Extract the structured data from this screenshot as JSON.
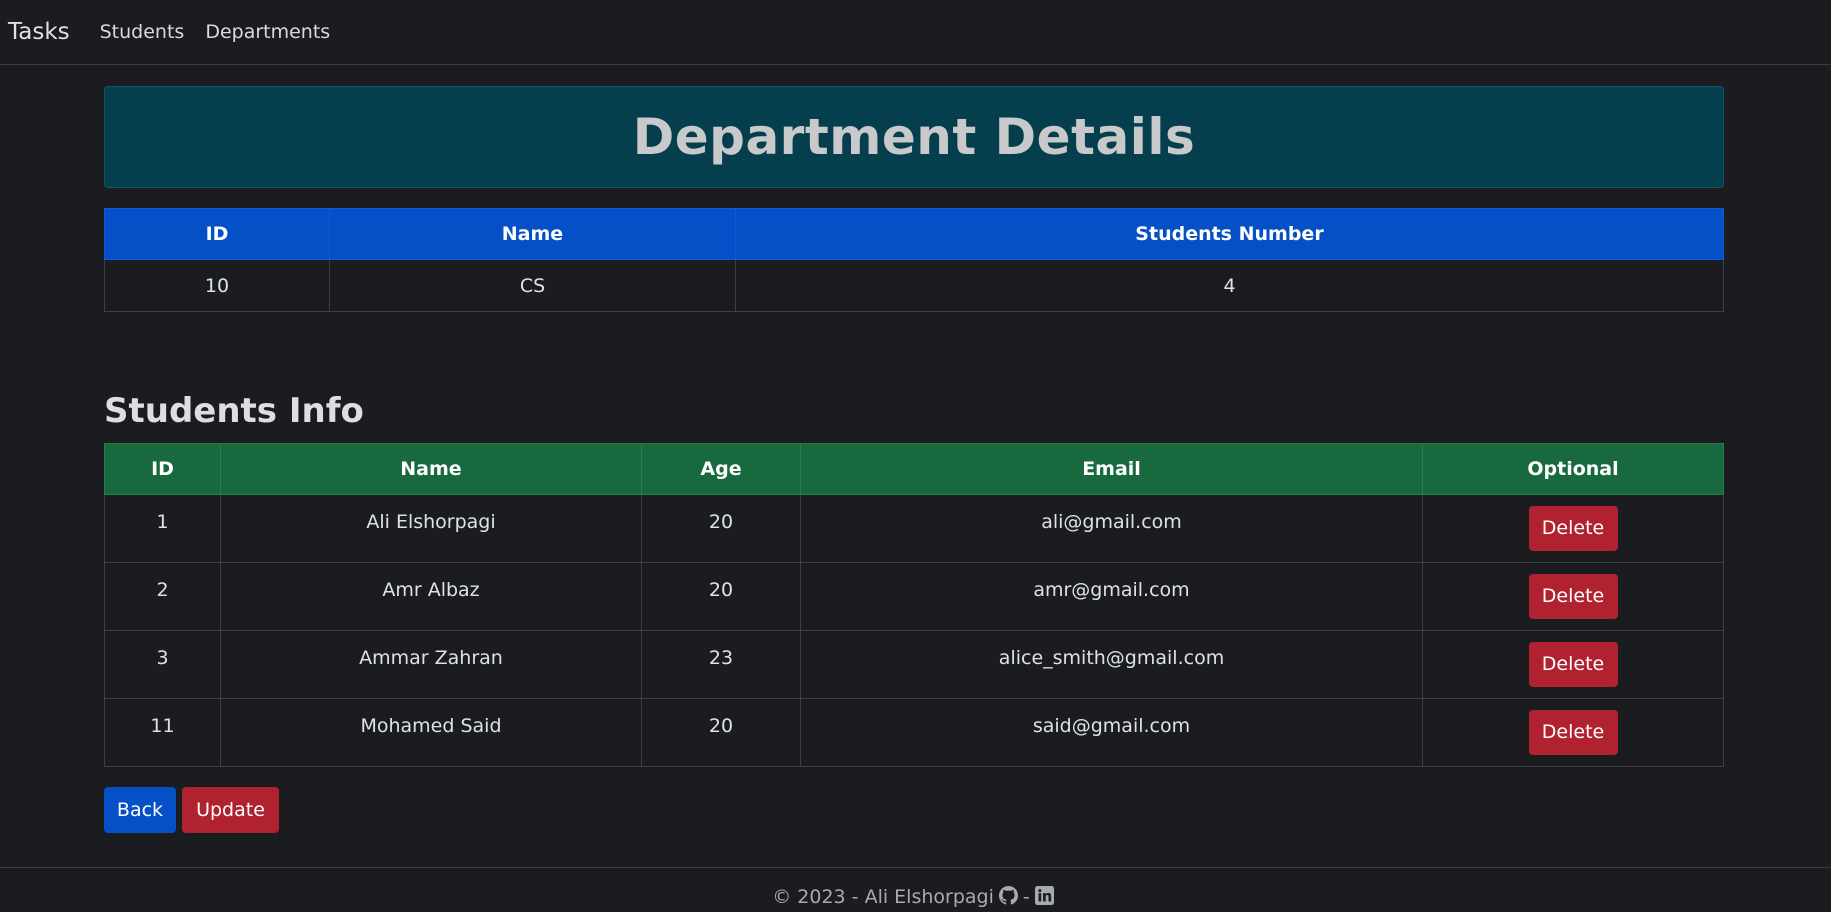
{
  "navbar": {
    "brand": "Tasks",
    "links": [
      "Students",
      "Departments"
    ]
  },
  "department": {
    "title": "Department Details",
    "headers": [
      "ID",
      "Name",
      "Students Number"
    ],
    "row": [
      "10",
      "CS",
      "4"
    ]
  },
  "students": {
    "title": "Students Info",
    "headers": [
      "ID",
      "Name",
      "Age",
      "Email",
      "Optional"
    ],
    "delete_label": "Delete",
    "rows": [
      {
        "id": "1",
        "name": "Ali Elshorpagi",
        "age": "20",
        "email": "ali@gmail.com"
      },
      {
        "id": "2",
        "name": "Amr Albaz",
        "age": "20",
        "email": "amr@gmail.com"
      },
      {
        "id": "3",
        "name": "Ammar Zahran",
        "age": "23",
        "email": "alice_smith@gmail.com"
      },
      {
        "id": "11",
        "name": "Mohamed Said",
        "age": "20",
        "email": "said@gmail.com"
      }
    ]
  },
  "actions": {
    "back_label": "Back",
    "update_label": "Update"
  },
  "footer": {
    "text": "© 2023 - Ali Elshorpagi",
    "separator": "-",
    "icons": [
      "github-icon",
      "linkedin-icon"
    ]
  }
}
